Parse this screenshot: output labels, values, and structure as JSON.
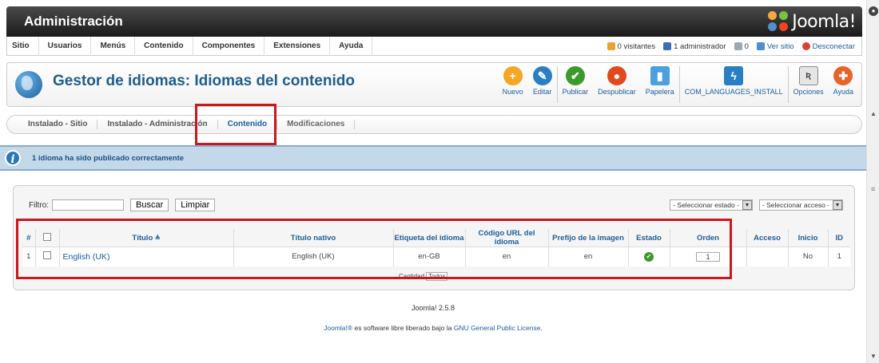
{
  "header": {
    "title": "Administración",
    "logo_text": "Joomla!"
  },
  "menu": [
    "Sitio",
    "Usuarios",
    "Menús",
    "Contenido",
    "Componentes",
    "Extensiones",
    "Ayuda"
  ],
  "status": {
    "visitors": "0 visitantes",
    "admins": "1 administrador",
    "messages": "0",
    "view_site": "Ver sitio",
    "logout": "Desconectar"
  },
  "page_title": "Gestor de idiomas: Idiomas del contenido",
  "toolbar": [
    {
      "label": "Nuevo",
      "icon": "plus-icon",
      "color": "#f5a623"
    },
    {
      "label": "Editar",
      "icon": "pencil-icon",
      "color": "#2a7fc4"
    },
    {
      "label": "Publicar",
      "icon": "check-icon",
      "color": "#3a9a2a"
    },
    {
      "label": "Despublicar",
      "icon": "unpublish-icon",
      "color": "#e24a1c"
    },
    {
      "label": "Papelera",
      "icon": "trash-icon",
      "color": "#4aa0e0"
    },
    {
      "label": "COM_LANGUAGES_INSTALL",
      "icon": "install-icon",
      "color": "#2a7fc4"
    },
    {
      "label": "Opciones",
      "icon": "options-icon",
      "color": "#aaaaaa"
    },
    {
      "label": "Ayuda",
      "icon": "help-icon",
      "color": "#e8632a"
    }
  ],
  "tabs": [
    "Instalado - Sitio",
    "Instalado - Administración",
    "Contenido",
    "Modificaciones"
  ],
  "message": "1 idioma ha sido publicado correctamente",
  "filter": {
    "label": "Filtro:",
    "value": "",
    "search_btn": "Buscar",
    "clear_btn": "Limpiar",
    "state_select": "- Seleccionar estado -",
    "access_select": "- Seleccionar acceso -"
  },
  "table": {
    "headers": [
      "#",
      "",
      "Título",
      "Título nativo",
      "Etiqueta del idioma",
      "Código URL del idioma",
      "Prefijo de la imagen",
      "Estado",
      "Orden",
      "Acceso",
      "Inicio",
      "ID"
    ],
    "rows": [
      {
        "num": "1",
        "title": "English (UK)",
        "native": "English (UK)",
        "tag": "en-GB",
        "url_code": "en",
        "image": "en",
        "order": "1",
        "access": "",
        "home": "No",
        "id": "1"
      }
    ]
  },
  "quantity": {
    "label": "Cantidad",
    "value": "Todos"
  },
  "footer": {
    "version": "Joomla! 2.5.8",
    "joomla_link": "Joomla!®",
    "text": "es software libre liberado bajo la",
    "license_link": "GNU General Public License",
    "period": "."
  }
}
